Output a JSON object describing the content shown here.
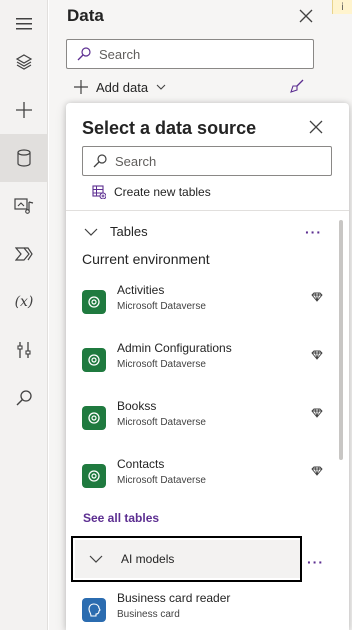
{
  "rail": {
    "items": [
      {
        "name": "tree-view-icon"
      },
      {
        "name": "insert-icon"
      },
      {
        "name": "data-icon",
        "active": true
      },
      {
        "name": "media-icon"
      },
      {
        "name": "power-automate-icon"
      },
      {
        "name": "variables-icon",
        "label": "(x)"
      },
      {
        "name": "advanced-tools-icon"
      },
      {
        "name": "search-icon"
      }
    ]
  },
  "data_panel": {
    "title": "Data",
    "search_placeholder": "Search",
    "add_data_label": "Add data"
  },
  "info_badge": "i",
  "popup": {
    "title": "Select a data source",
    "search_placeholder": "Search",
    "create_new_label": "Create new tables",
    "tables_section": "Tables",
    "more_label": "···",
    "environment_label": "Current environment",
    "tables": [
      {
        "name": "Activities",
        "source": "Microsoft Dataverse"
      },
      {
        "name": "Admin Configurations",
        "source": "Microsoft Dataverse"
      },
      {
        "name": "Bookss",
        "source": "Microsoft Dataverse"
      },
      {
        "name": "Contacts",
        "source": "Microsoft Dataverse"
      }
    ],
    "see_all_label": "See all tables",
    "ai_section": "AI models",
    "ai_items": [
      {
        "name": "Business card reader",
        "source": "Business card"
      }
    ]
  },
  "colors": {
    "accent": "#5c2e91",
    "dataverse_green": "#1f7a3f",
    "ai_blue": "#2b6cb0"
  }
}
